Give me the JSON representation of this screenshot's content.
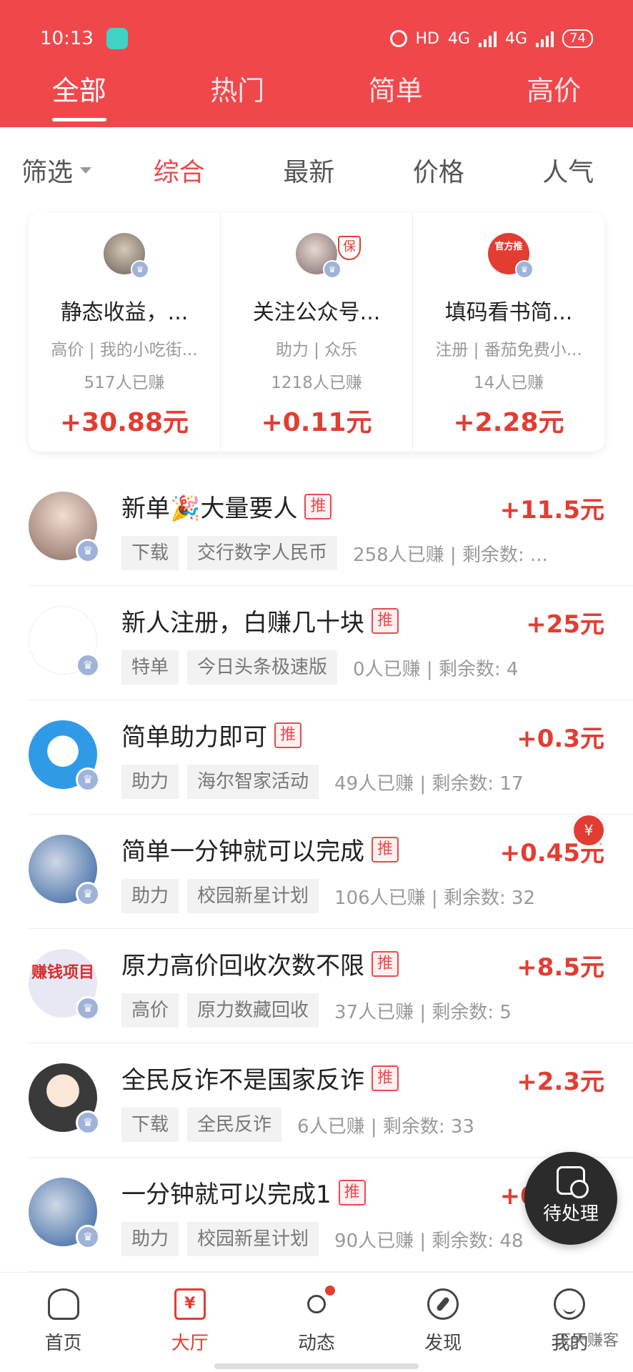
{
  "status_bar": {
    "time": "10:13",
    "hd": "HD",
    "net1": "4G",
    "net2": "4G",
    "battery": "74"
  },
  "top_tabs": [
    {
      "label": "全部",
      "active": true
    },
    {
      "label": "热门",
      "active": false
    },
    {
      "label": "简单",
      "active": false
    },
    {
      "label": "高价",
      "active": false
    }
  ],
  "filter": {
    "label": "筛选",
    "sorts": [
      "综合",
      "最新",
      "价格",
      "人气"
    ],
    "active_sort": "综合"
  },
  "featured": [
    {
      "title": "静态收益，...",
      "sub": "高价 | 我的小吃街...",
      "count": "517人已赚",
      "price": "+30.88元"
    },
    {
      "title": "关注公众号...",
      "sub": "助力 | 众乐",
      "count": "1218人已赚",
      "price": "+0.11元",
      "badge": "保"
    },
    {
      "title": "填码看书简...",
      "sub": "注册 | 番茄免费小...",
      "count": "14人已赚",
      "price": "+2.28元",
      "avatar_text": "官方推"
    }
  ],
  "tasks": [
    {
      "title": "新单🎉大量要人",
      "tag": "推",
      "price": "+11.5元",
      "type": "下载",
      "app": "交行数字人民币",
      "meta": "258人已赚 | 剩余数: ..."
    },
    {
      "title": "新人注册，白赚几十块",
      "tag": "推",
      "price": "+25元",
      "type": "特单",
      "app": "今日头条极速版",
      "meta": "0人已赚 | 剩余数: 4"
    },
    {
      "title": "简单助力即可",
      "tag": "推",
      "price": "+0.3元",
      "type": "助力",
      "app": "海尔智家活动",
      "meta": "49人已赚 | 剩余数: 17"
    },
    {
      "title": "简单一分钟就可以完成",
      "tag": "推",
      "price": "+0.45元",
      "type": "助力",
      "app": "校园新星计划",
      "meta": "106人已赚 | 剩余数: 32"
    },
    {
      "title": "原力高价回收次数不限",
      "tag": "推",
      "price": "+8.5元",
      "type": "高价",
      "app": "原力数藏回收",
      "meta": "37人已赚 | 剩余数: 5",
      "avatar_text": "赚钱项目"
    },
    {
      "title": "全民反诈不是国家反诈",
      "tag": "推",
      "price": "+2.3元",
      "type": "下载",
      "app": "全民反诈",
      "meta": "6人已赚 | 剩余数: 33"
    },
    {
      "title": "一分钟就可以完成1",
      "tag": "推",
      "price": "+0.45元",
      "type": "助力",
      "app": "校园新星计划",
      "meta": "90人已赚 | 剩余数: 48"
    }
  ],
  "red_packet": "¥",
  "pending": {
    "label": "待处理"
  },
  "bottom_nav": [
    {
      "label": "首页",
      "icon": "home-icon"
    },
    {
      "label": "大厅",
      "icon": "hall-icon",
      "active": true,
      "glyph": "¥"
    },
    {
      "label": "动态",
      "icon": "dynamics-icon"
    },
    {
      "label": "发现",
      "icon": "compass-icon"
    },
    {
      "label": "我的",
      "icon": "profile-icon"
    }
  ],
  "watermark": "天天赚客",
  "colors": {
    "brand_red": "#f0474b",
    "price_red": "#e23d32",
    "pending_dark": "#2b2b2b"
  }
}
